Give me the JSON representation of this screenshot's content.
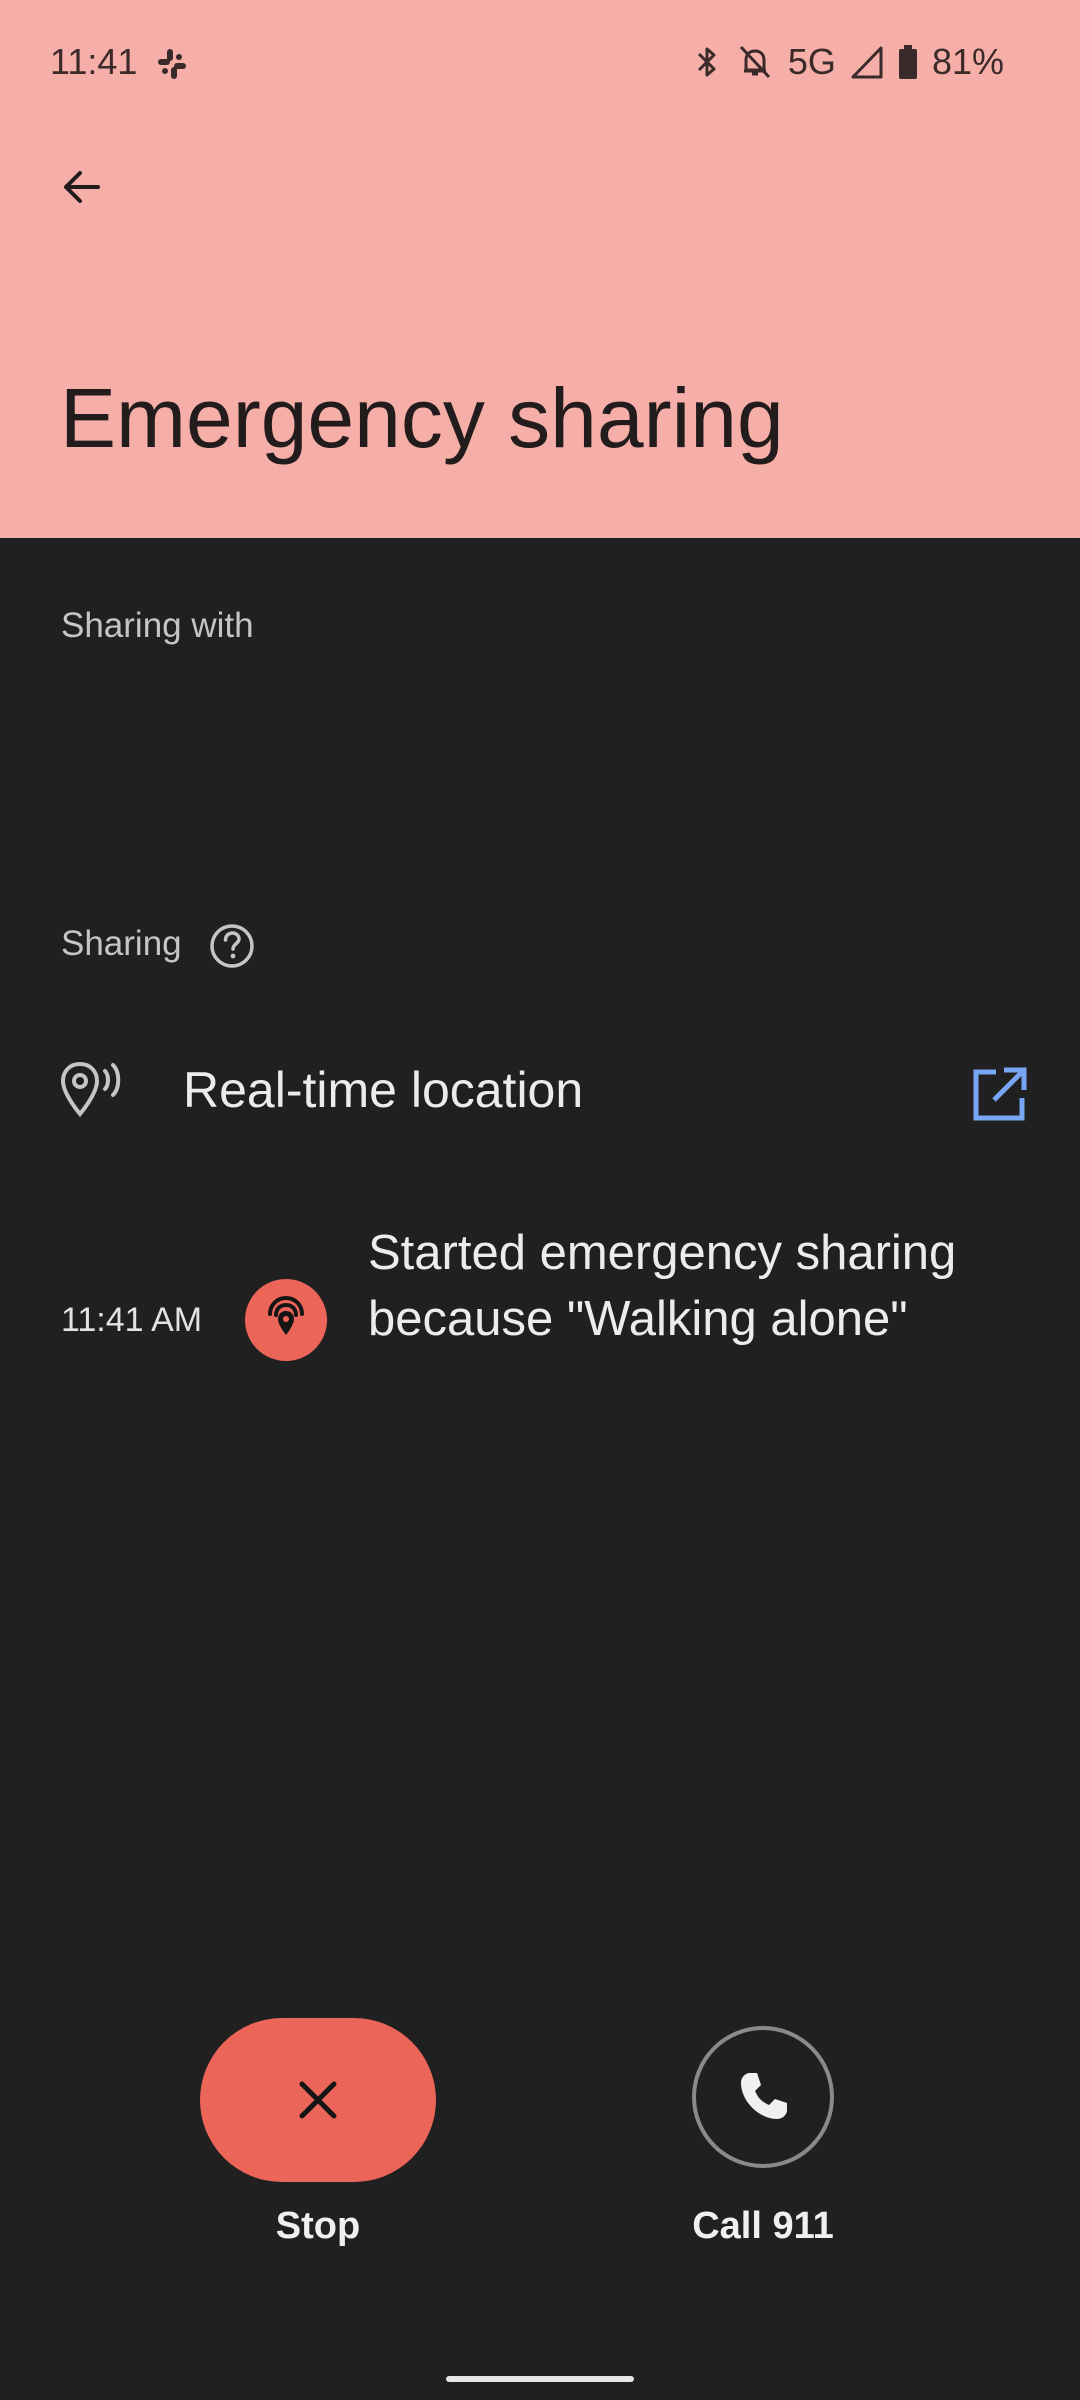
{
  "status_bar": {
    "time": "11:41",
    "network": "5G",
    "battery": "81%",
    "icons": [
      "slack-icon",
      "bluetooth-icon",
      "bell-off-icon",
      "signal-icon",
      "battery-icon"
    ]
  },
  "header": {
    "title": "Emergency sharing",
    "background_color": "#f6aea8"
  },
  "sections": {
    "sharing_with_label": "Sharing with",
    "sharing_label": "Sharing"
  },
  "location_item": {
    "label": "Real-time location",
    "icon": "location-sharing-icon",
    "action_icon": "open-external-icon"
  },
  "event": {
    "time": "11:41 AM",
    "text": "Started emergency sharing because \"Walking alone\"",
    "icon": "emergency-sharing-icon"
  },
  "actions": {
    "stop_label": "Stop",
    "call_label": "Call 911",
    "accent_color": "#ec6559"
  }
}
